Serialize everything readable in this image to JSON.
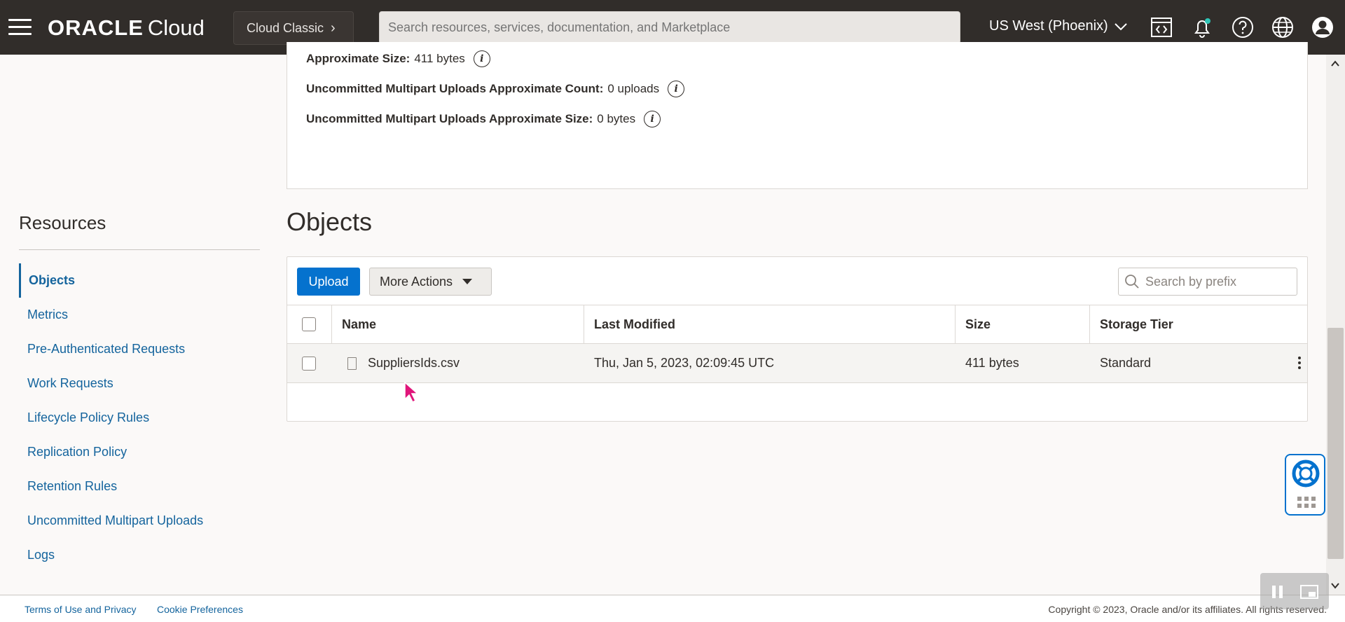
{
  "topbar": {
    "brand": "ORACLE",
    "product": "Cloud",
    "cloud_classic": "Cloud Classic",
    "search_placeholder": "Search resources, services, documentation, and Marketplace",
    "region": "US West (Phoenix)"
  },
  "info": {
    "rows": [
      {
        "label": "Approximate Size:",
        "value": "411 bytes"
      },
      {
        "label": "Uncommitted Multipart Uploads Approximate Count:",
        "value": "0 uploads"
      },
      {
        "label": "Uncommitted Multipart Uploads Approximate Size:",
        "value": "0 bytes"
      }
    ]
  },
  "resources": {
    "title": "Resources",
    "items": [
      {
        "label": "Objects",
        "active": true
      },
      {
        "label": "Metrics"
      },
      {
        "label": "Pre-Authenticated Requests"
      },
      {
        "label": "Work Requests"
      },
      {
        "label": "Lifecycle Policy Rules"
      },
      {
        "label": "Replication Policy"
      },
      {
        "label": "Retention Rules"
      },
      {
        "label": "Uncommitted Multipart Uploads"
      },
      {
        "label": "Logs"
      }
    ]
  },
  "objects": {
    "title": "Objects",
    "upload_label": "Upload",
    "more_actions_label": "More Actions",
    "search_placeholder": "Search by prefix",
    "columns": [
      "Name",
      "Last Modified",
      "Size",
      "Storage Tier"
    ],
    "rows": [
      {
        "name": "SuppliersIds.csv",
        "last_modified": "Thu, Jan 5, 2023, 02:09:45 UTC",
        "size": "411 bytes",
        "tier": "Standard"
      }
    ]
  },
  "footer": {
    "terms": "Terms of Use and Privacy",
    "cookies": "Cookie Preferences",
    "copyright": "Copyright © 2023, Oracle and/or its affiliates. All rights reserved."
  },
  "icons": [
    "menu-icon",
    "chevron-right-icon",
    "chevron-down-icon",
    "code-editor-icon",
    "bell-icon",
    "help-icon",
    "globe-icon",
    "user-icon",
    "info-icon",
    "search-icon",
    "file-icon",
    "kebab-icon",
    "lifebuoy-icon",
    "grid-icon",
    "mouse-pointer-icon"
  ],
  "colors": {
    "topbar": "#312d2a",
    "accent": "#0572ce",
    "link": "#14649d",
    "notification_dot": "#2ec4b6"
  }
}
